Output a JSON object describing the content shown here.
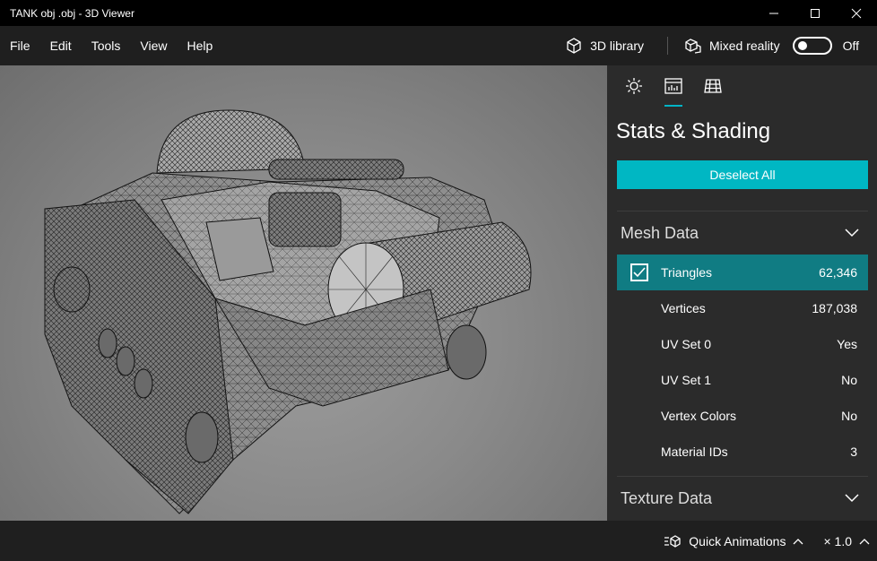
{
  "window": {
    "title": "TANK obj .obj - 3D Viewer"
  },
  "menu": {
    "items": [
      "File",
      "Edit",
      "Tools",
      "View",
      "Help"
    ],
    "library_label": "3D library",
    "mixed_reality_label": "Mixed reality",
    "mixed_reality_state": "Off"
  },
  "panel": {
    "title": "Stats & Shading",
    "deselect_label": "Deselect All",
    "mesh_section": "Mesh Data",
    "texture_section": "Texture Data",
    "rows": [
      {
        "label": "Triangles",
        "value": "62,346",
        "selected": true
      },
      {
        "label": "Vertices",
        "value": "187,038"
      },
      {
        "label": "UV Set 0",
        "value": "Yes"
      },
      {
        "label": "UV Set 1",
        "value": "No"
      },
      {
        "label": "Vertex Colors",
        "value": "No"
      },
      {
        "label": "Material IDs",
        "value": "3"
      }
    ]
  },
  "bottom": {
    "quick_animations_label": "Quick Animations",
    "speed_label": "× 1.0"
  },
  "colors": {
    "accent": "#00b7c3",
    "selected_row": "#107c83"
  }
}
